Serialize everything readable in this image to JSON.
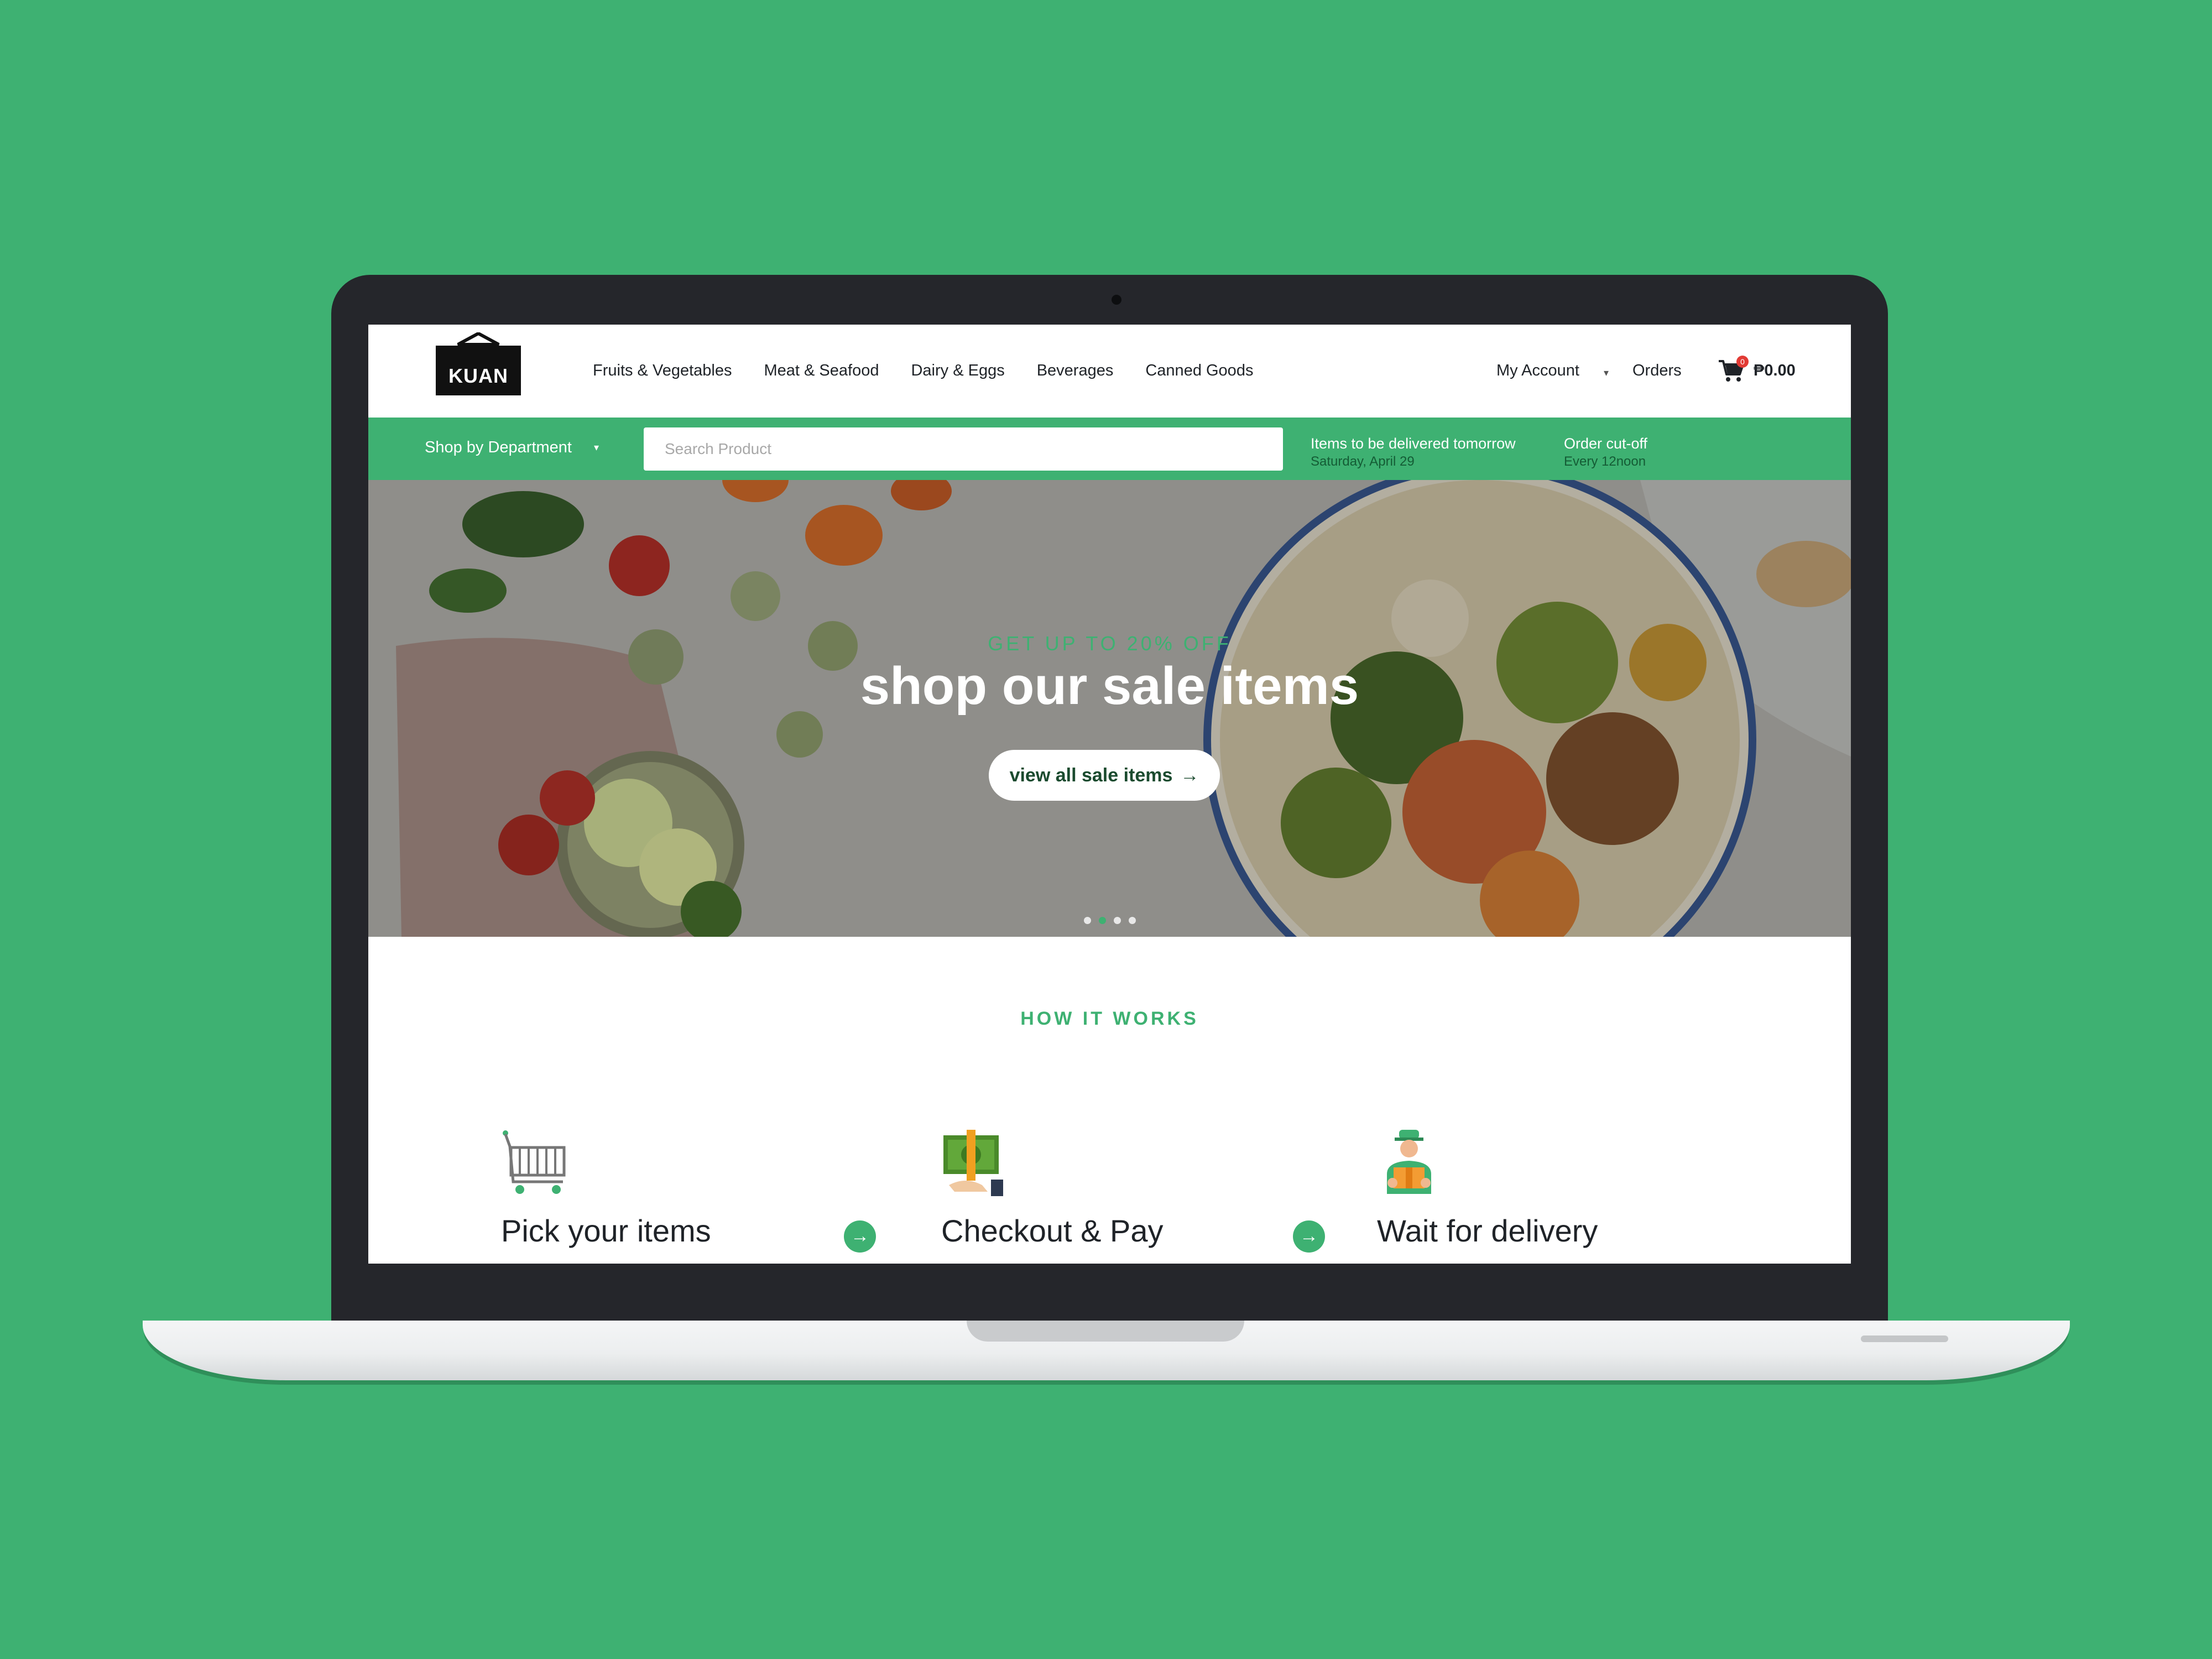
{
  "brand": {
    "name": "KUAN"
  },
  "nav": {
    "links": [
      "Fruits & Vegetables",
      "Meat & Seafood",
      "Dairy & Eggs",
      "Beverages",
      "Canned Goods"
    ],
    "account_label": "My Account",
    "orders_label": "Orders",
    "cart": {
      "count": "0",
      "total": "₱0.00"
    }
  },
  "subbar": {
    "department_label": "Shop by Department",
    "search_placeholder": "Search Product",
    "delivery_title": "Items to be delivered tomorrow",
    "delivery_date": "Saturday, April 29",
    "cutoff_title": "Order cut-off",
    "cutoff_time": "Every 12noon"
  },
  "hero": {
    "eyebrow": "GET UP TO 20% OFF",
    "title": "shop our sale items",
    "button_label": "view all sale items",
    "slides": 4,
    "active_slide": 2
  },
  "how_it_works": {
    "title": "HOW IT WORKS",
    "steps": [
      {
        "label": "Pick your items",
        "icon": "shopping-cart-icon"
      },
      {
        "label": "Checkout & Pay",
        "icon": "cash-payment-icon"
      },
      {
        "label": "Wait for delivery",
        "icon": "delivery-person-icon"
      }
    ]
  },
  "colors": {
    "background": "#3eb172",
    "accent": "#3eb172",
    "laptop_frame": "#25262b",
    "badge": "#e23b35"
  }
}
